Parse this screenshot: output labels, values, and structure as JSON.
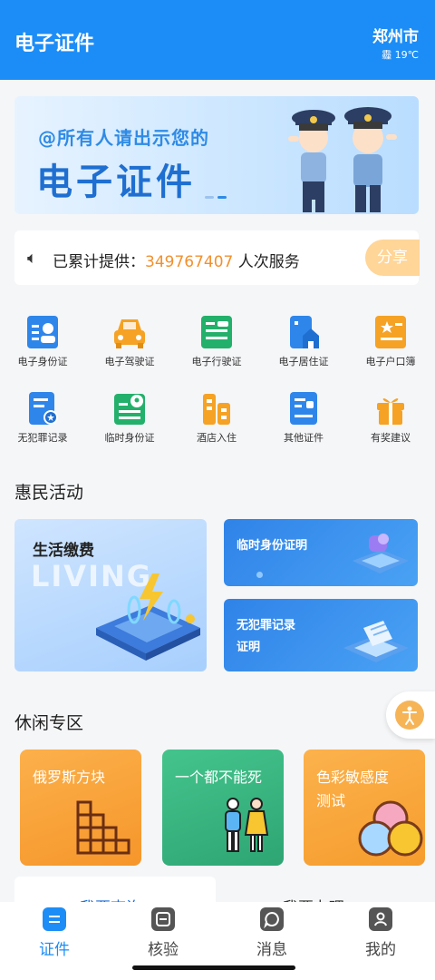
{
  "header": {
    "title": "电子证件",
    "city": "郑州市",
    "weather": "霾 19℃"
  },
  "banner": {
    "line1": "@所有人请出示您的",
    "line2": "电子证件"
  },
  "stats": {
    "prefix": "已累计提供：",
    "count": "349767407",
    "suffix": "人次服务",
    "share": "分享"
  },
  "grid": [
    {
      "label": "电子身份证",
      "icon": "id-card-icon",
      "color": "#2f86ea"
    },
    {
      "label": "电子驾驶证",
      "icon": "car-icon",
      "color": "#f5a225"
    },
    {
      "label": "电子行驶证",
      "icon": "vehicle-license-icon",
      "color": "#23b06b"
    },
    {
      "label": "电子居住证",
      "icon": "house-icon",
      "color": "#2f86ea"
    },
    {
      "label": "电子户口簿",
      "icon": "household-register-icon",
      "color": "#f5a225"
    },
    {
      "label": "无犯罪记录",
      "icon": "no-crime-record-icon",
      "color": "#2f86ea"
    },
    {
      "label": "临时身份证",
      "icon": "temporary-id-icon",
      "color": "#23b06b"
    },
    {
      "label": "酒店入住",
      "icon": "hotel-icon",
      "color": "#f5a225"
    },
    {
      "label": "其他证件",
      "icon": "other-document-icon",
      "color": "#2f86ea"
    },
    {
      "label": "有奖建议",
      "icon": "gift-icon",
      "color": "#f5a225"
    }
  ],
  "sections": {
    "activities": "惠民活动",
    "leisure": "休闲专区"
  },
  "activities": {
    "big": {
      "title": "生活缴费",
      "en": "LIVING"
    },
    "s1": {
      "title": "临时身份证明"
    },
    "s2": {
      "title_line1": "无犯罪记录",
      "title_line2": "证明"
    }
  },
  "games": [
    {
      "title": "俄罗斯方块"
    },
    {
      "title": "一个都不能死"
    },
    {
      "title_line1": "色彩敏感度",
      "title_line2": "测试"
    }
  ],
  "peek": {
    "left": "我要查询",
    "right": "我要办理"
  },
  "nav": [
    {
      "label": "证件",
      "icon": "document-icon",
      "active": true
    },
    {
      "label": "核验",
      "icon": "verify-icon",
      "active": false
    },
    {
      "label": "消息",
      "icon": "message-icon",
      "active": false
    },
    {
      "label": "我的",
      "icon": "profile-icon",
      "active": false
    }
  ]
}
